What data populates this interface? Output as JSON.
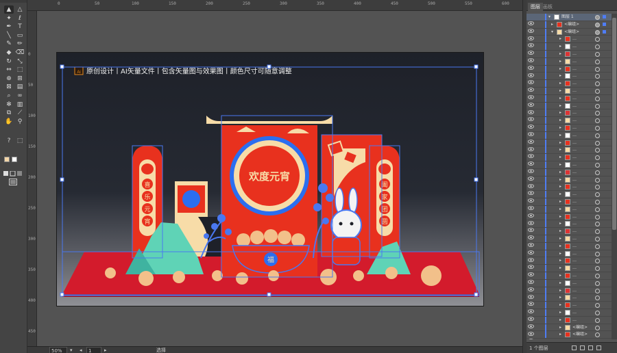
{
  "toolbar": {
    "tools": [
      {
        "name": "selection-tool",
        "glyph": "▲",
        "active": true
      },
      {
        "name": "direct-selection-tool",
        "glyph": "△"
      },
      {
        "name": "magic-wand-tool",
        "glyph": "✦"
      },
      {
        "name": "lasso-tool",
        "glyph": "ℓ"
      },
      {
        "name": "pen-tool",
        "glyph": "✒"
      },
      {
        "name": "type-tool",
        "glyph": "T"
      },
      {
        "name": "line-tool",
        "glyph": "╲"
      },
      {
        "name": "rectangle-tool",
        "glyph": "▭"
      },
      {
        "name": "paintbrush-tool",
        "glyph": "✎"
      },
      {
        "name": "pencil-tool",
        "glyph": "✏"
      },
      {
        "name": "blob-brush-tool",
        "glyph": "◆"
      },
      {
        "name": "eraser-tool",
        "glyph": "⌫"
      },
      {
        "name": "rotate-tool",
        "glyph": "↻"
      },
      {
        "name": "scale-tool",
        "glyph": "⤡"
      },
      {
        "name": "width-tool",
        "glyph": "⇔"
      },
      {
        "name": "free-transform-tool",
        "glyph": "⬚"
      },
      {
        "name": "shape-builder-tool",
        "glyph": "⊕"
      },
      {
        "name": "perspective-grid-tool",
        "glyph": "⊞"
      },
      {
        "name": "mesh-tool",
        "glyph": "⊠"
      },
      {
        "name": "gradient-tool",
        "glyph": "▤"
      },
      {
        "name": "eyedropper-tool",
        "glyph": "⌕"
      },
      {
        "name": "blend-tool",
        "glyph": "∞"
      },
      {
        "name": "symbol-sprayer-tool",
        "glyph": "✻"
      },
      {
        "name": "column-graph-tool",
        "glyph": "▥"
      },
      {
        "name": "artboard-tool",
        "glyph": "⧉"
      },
      {
        "name": "slice-tool",
        "glyph": "⟋"
      },
      {
        "name": "hand-tool",
        "glyph": "✋"
      },
      {
        "name": "zoom-tool",
        "glyph": "⚲"
      }
    ],
    "extra_labels": [
      "?",
      "⬚"
    ]
  },
  "rulers": {
    "top": [
      "0",
      "50",
      "100",
      "150",
      "200",
      "250",
      "300",
      "350",
      "400",
      "450",
      "500",
      "550",
      "600"
    ],
    "left": [
      "0",
      "50",
      "100",
      "150",
      "200",
      "250",
      "300",
      "350",
      "400",
      "450"
    ]
  },
  "artboard": {
    "ai_badge": "Ai",
    "caption": "原创设计丨AI矢量文件丨包含矢量图与效果图丨颜色尺寸可随意调整"
  },
  "artwork": {
    "left_vertical_chars": [
      "喜",
      "乐",
      "元",
      "宵"
    ],
    "right_vertical_chars": [
      "阖",
      "家",
      "团",
      "圆"
    ],
    "center_circle_title": "欢度元宵",
    "bowl_mark": "福",
    "colors": {
      "red": "#e8311e",
      "cream": "#f7dca8",
      "selection_blue": "#4a78f0",
      "floor": "#d31b2c",
      "mountain_teal": "#5fd3b6",
      "ball": "#f2c08a"
    }
  },
  "statusbar": {
    "zoom": "50%",
    "page": "1",
    "tool_label": "选择"
  },
  "layers_panel": {
    "tabs": [
      "图层",
      "画板"
    ],
    "active_tab": "图层",
    "top_layer_name": "图层 1",
    "group_label": "<编组>",
    "count_label": "1 个图层"
  }
}
